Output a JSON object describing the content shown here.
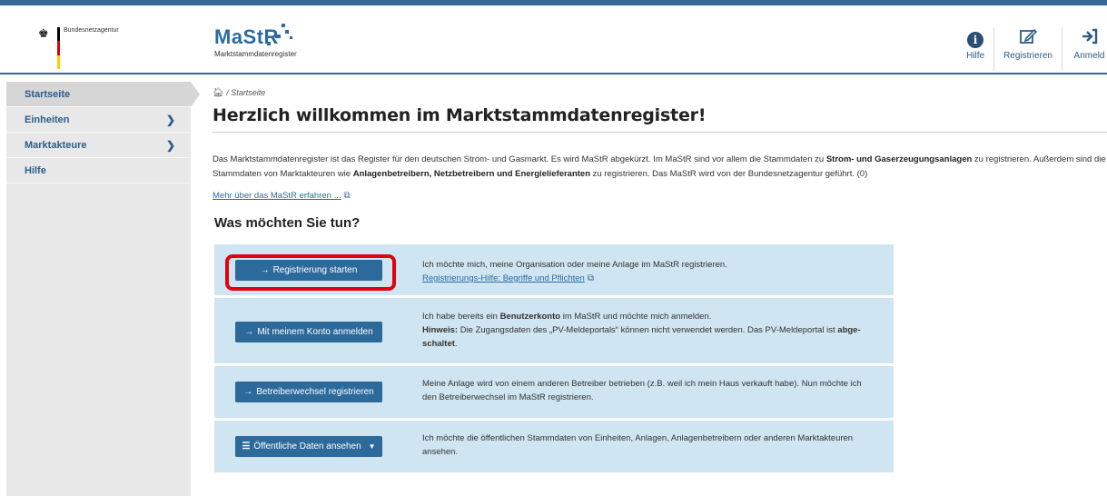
{
  "header": {
    "agency_name": "Bundesnetzagentur",
    "logo_title": "MaStR",
    "logo_subtitle": "Marktstammdatenregister",
    "nav": [
      {
        "label": "Hilfe",
        "icon": "info-circle-icon"
      },
      {
        "label": "Registrieren",
        "icon": "edit-icon"
      },
      {
        "label": "Anmeld",
        "icon": "sign-in-icon"
      }
    ]
  },
  "sidebar": {
    "items": [
      {
        "label": "Startseite",
        "has_children": false,
        "active": true
      },
      {
        "label": "Einheiten",
        "has_children": true,
        "active": false
      },
      {
        "label": "Marktakteure",
        "has_children": true,
        "active": false
      },
      {
        "label": "Hilfe",
        "has_children": false,
        "active": false
      }
    ]
  },
  "breadcrumb": {
    "current": "Startseite"
  },
  "main": {
    "title": "Herzlich willkommen im Marktstammdatenregister!",
    "intro": {
      "p1": "Das Marktstammdatenregister ist das Register für den deutschen Strom- und Gasmarkt. Es wird MaStR abgekürzt. Im MaStR sind vor allem die Stammdaten zu ",
      "b1": "Strom- und Gaserzeugungsanlagen",
      "p2": " zu registrieren. Außerdem sind die Stammdaten von Marktakteuren wie ",
      "b2": "Anlagenbetreibern, Netzbetreibern und Energielieferanten",
      "p3": " zu registrieren. Das MaStR wird von der Bundesnetzagentur geführt. (0)"
    },
    "more_link": "Mehr über das MaStR erfahren ...",
    "section_title": "Was möchten Sie tun?",
    "actions": [
      {
        "button": "Registrierung starten",
        "text": "Ich möchte mich, meine Organisation oder meine Anlage im MaStR registrieren.",
        "link": "Registrierungs-Hilfe: Begriffe und Pflichten"
      },
      {
        "button": "Mit meinem Konto anmelden",
        "text_pre": "Ich habe bereits ein ",
        "text_bold": "Benutzerkonto",
        "text_post": " im MaStR und möchte mich anmelden.",
        "hint_label": "Hinweis:",
        "hint_text": " Die Zugangsdaten des „PV-Meldeportals“ können nicht verwendet werden. Das PV-Meldeportal ist ",
        "hint_bold": "abge­schaltet",
        "hint_end": "."
      },
      {
        "button": "Betreiberwechsel registrieren",
        "text": "Meine Anlage wird von einem anderen Betreiber betrieben (z.B. weil ich mein Haus verkauft habe). Nun möchte ich den Betreiberwechsel im MaStR registrieren."
      },
      {
        "button": "Öffentliche Daten ansehen",
        "text": "Ich möchte die öffentlichen Stammdaten von Einheiten, Anlagen, Anlagenbetreibern oder anderen Marktakteuren ansehen."
      }
    ]
  },
  "colors": {
    "primary": "#2d6a9c",
    "action_bg": "#cfe5f1",
    "highlight": "#e3000f",
    "sidebar_bg": "#e8e8e8"
  }
}
